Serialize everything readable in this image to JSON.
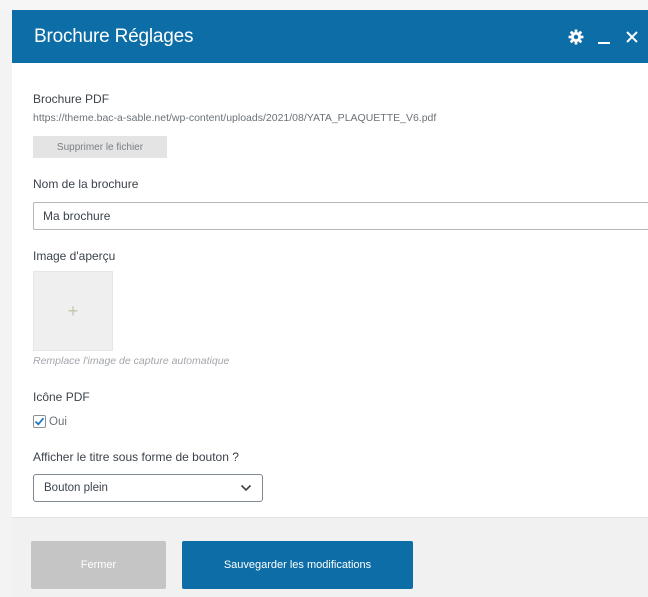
{
  "dialog": {
    "title": "Brochure Réglages"
  },
  "fields": {
    "pdf": {
      "label": "Brochure PDF",
      "url": "https://theme.bac-a-sable.net/wp-content/uploads/2021/08/YATA_PLAQUETTE_V6.pdf",
      "remove_label": "Supprimer le fichier"
    },
    "name": {
      "label": "Nom de la brochure",
      "value": "Ma brochure"
    },
    "preview": {
      "label": "Image d'aperçu",
      "hint": "Remplace l'image de capture automatique"
    },
    "pdf_icon": {
      "label": "Icône PDF",
      "option_label": "Oui",
      "checked": true
    },
    "button_title": {
      "label": "Afficher le titre sous forme de bouton ?",
      "selected": "Bouton plein"
    }
  },
  "footer": {
    "close_label": "Fermer",
    "save_label": "Sauvegarder les modifications"
  },
  "colors": {
    "header_bg": "#0d6da6",
    "save_bg": "#0d6da6",
    "close_bg": "#c5c5c5"
  },
  "icons": [
    "gear-icon",
    "minimize-icon",
    "close-icon",
    "plus-icon",
    "check-icon",
    "chevron-down-icon"
  ]
}
